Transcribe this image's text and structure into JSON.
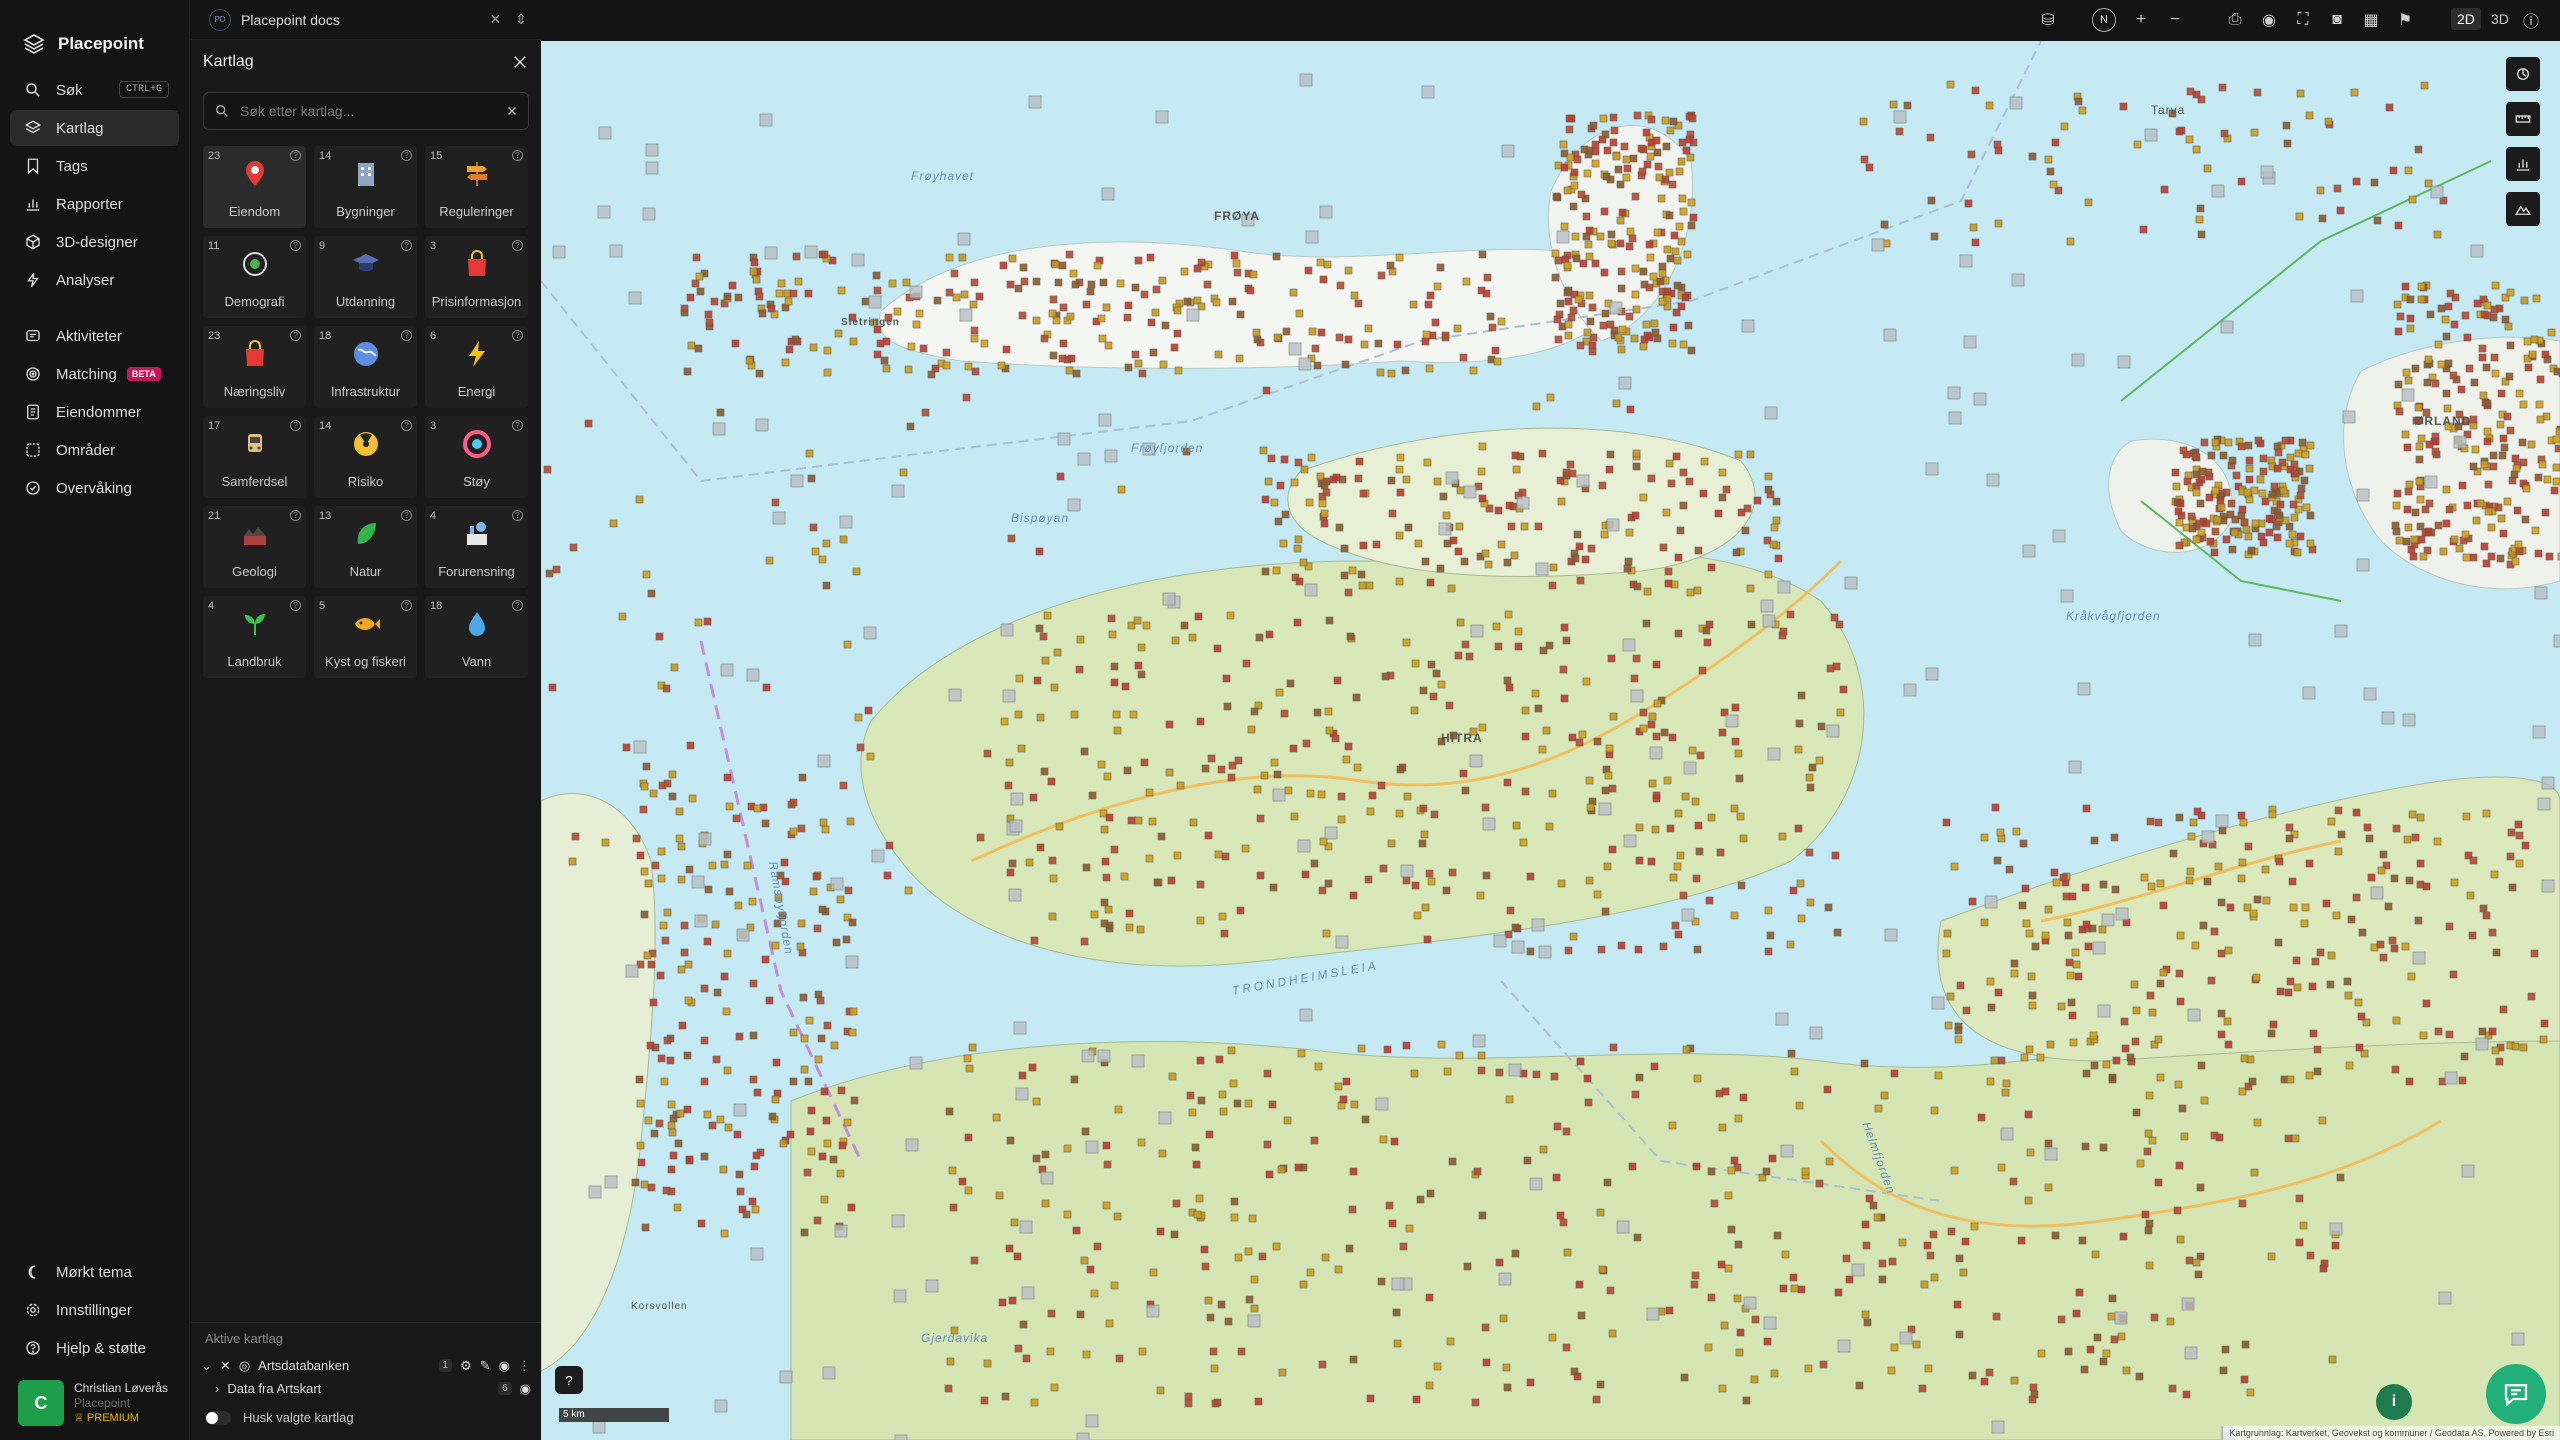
{
  "app": {
    "name": "Placepoint"
  },
  "nav": {
    "search": {
      "label": "Søk",
      "shortcut": "CTRL+G"
    },
    "items": [
      {
        "key": "kartlag",
        "label": "Kartlag",
        "icon": "layers-icon",
        "active": true
      },
      {
        "key": "tags",
        "label": "Tags",
        "icon": "bookmark-icon"
      },
      {
        "key": "rapporter",
        "label": "Rapporter",
        "icon": "bar-chart-icon"
      },
      {
        "key": "3d-designer",
        "label": "3D-designer",
        "icon": "cube-icon"
      },
      {
        "key": "analyser",
        "label": "Analyser",
        "icon": "bolt-icon"
      }
    ],
    "items2": [
      {
        "key": "aktiviteter",
        "label": "Aktiviteter",
        "icon": "activity-icon"
      },
      {
        "key": "matching",
        "label": "Matching",
        "badge": "BETA",
        "icon": "target-icon"
      },
      {
        "key": "eiendommer",
        "label": "Eiendommer",
        "icon": "document-icon"
      },
      {
        "key": "omrader",
        "label": "Områder",
        "icon": "area-icon"
      },
      {
        "key": "overvaking",
        "label": "Overvåking",
        "icon": "check-circle-icon"
      }
    ],
    "bottom": [
      {
        "key": "morkt-tema",
        "label": "Mørkt tema",
        "icon": "moon-icon"
      },
      {
        "key": "innstillinger",
        "label": "Innstillinger",
        "icon": "gear-icon"
      },
      {
        "key": "hjelp",
        "label": "Hjelp & støtte",
        "icon": "help-icon"
      }
    ],
    "user": {
      "initial": "C",
      "name": "Christian Løverås",
      "org": "Placepoint",
      "plan": "PREMIUM"
    }
  },
  "tab": {
    "badge": "PD",
    "title": "Placepoint docs"
  },
  "panel": {
    "title": "Kartlag",
    "search_placeholder": "Søk etter kartlag...",
    "categories": [
      {
        "count": "23",
        "label": "Eiendom",
        "icon": "map-pin-icon",
        "color": "#e53935"
      },
      {
        "count": "14",
        "label": "Bygninger",
        "icon": "building-icon",
        "color": "#8fa3c7"
      },
      {
        "count": "15",
        "label": "Reguleringer",
        "icon": "signpost-icon",
        "color": "#f0a030"
      },
      {
        "count": "11",
        "label": "Demografi",
        "icon": "demographics-icon",
        "color": "#dddddd"
      },
      {
        "count": "9",
        "label": "Utdanning",
        "icon": "graduation-cap-icon",
        "color": "#5a6fb0"
      },
      {
        "count": "3",
        "label": "Prisinformasjon",
        "icon": "shopping-bag-icon",
        "color": "#e53935"
      },
      {
        "count": "23",
        "label": "Næringsliv",
        "icon": "shopping-bag-icon",
        "color": "#e53935"
      },
      {
        "count": "18",
        "label": "Infrastruktur",
        "icon": "globe-icon",
        "color": "#5c8fe0"
      },
      {
        "count": "6",
        "label": "Energi",
        "icon": "lightning-icon",
        "color": "#ffc107"
      },
      {
        "count": "17",
        "label": "Samferdsel",
        "icon": "bus-icon",
        "color": "#e0c080"
      },
      {
        "count": "14",
        "label": "Risiko",
        "icon": "radiation-icon",
        "color": "#f0c030"
      },
      {
        "count": "3",
        "label": "Støy",
        "icon": "noise-gauge-icon",
        "color": "#ff5a8a"
      },
      {
        "count": "21",
        "label": "Geologi",
        "icon": "geology-icon",
        "color": "#b04040"
      },
      {
        "count": "13",
        "label": "Natur",
        "icon": "leaf-icon",
        "color": "#2fb34a"
      },
      {
        "count": "4",
        "label": "Forurensning",
        "icon": "factory-icon",
        "color": "#7fb7e8"
      },
      {
        "count": "4",
        "label": "Landbruk",
        "icon": "sprout-icon",
        "color": "#3bbf4e"
      },
      {
        "count": "5",
        "label": "Kyst og fiskeri",
        "icon": "fish-icon",
        "color": "#f5a623"
      },
      {
        "count": "18",
        "label": "Vann",
        "icon": "water-drop-icon",
        "color": "#4aa8e8"
      }
    ],
    "active_title": "Aktive kartlag",
    "active_layers": [
      {
        "label": "Artsdatabanken",
        "count": "1"
      },
      {
        "label": "Data fra Artskart",
        "count": "6"
      }
    ],
    "remember_label": "Husk valgte kartlag"
  },
  "toolbar": {
    "compass_label": "N",
    "mode_2d": "2D",
    "mode_3d": "3D"
  },
  "map": {
    "labels": [
      "Frøyhavet",
      "FRØYA",
      "Frøyfjorden",
      "Bispøyan",
      "Sletringen",
      "HITRA",
      "Ramsøyfjorden",
      "TRONDHEIMSLEIA",
      "Helmfjorden",
      "ØRLAND",
      "Kråkvågfjorden",
      "Tarva",
      "Gjerdavika",
      "Korsvollen"
    ],
    "scale_label": "5 km",
    "attribution": "Kartgrunnlag: Kartverket, Geovekst og kommuner / Geodata AS, Powered by Esri"
  }
}
